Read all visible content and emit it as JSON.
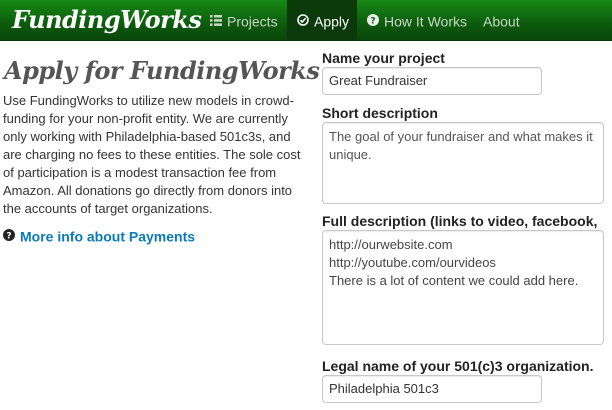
{
  "navbar": {
    "brand": "FundingWorks",
    "items": [
      {
        "label": "Projects",
        "icon": "list-icon",
        "active": false
      },
      {
        "label": "Apply",
        "icon": "check-circle-icon",
        "active": true
      },
      {
        "label": "How It Works",
        "icon": "question-circle-icon",
        "active": false
      },
      {
        "label": "About",
        "icon": "",
        "active": false
      }
    ],
    "colors": {
      "bar": "#0d5e0d",
      "active": "#0a3a0a"
    }
  },
  "intro": {
    "title": "Apply for FundingWorks",
    "body": "Use FundingWorks to utilize new models in crowd-funding for your non-profit entity. We are currently only working with Philadelphia-based 501c3s, and are charging no fees to these entities. The sole cost of participation is a modest transaction fee from Amazon. All donations go directly from donors into the accounts of target organizations.",
    "more_info": "More info about Payments",
    "link_color": "#0a7bb8"
  },
  "form": {
    "project_name": {
      "label": "Name your project",
      "value": "Great Fundraiser"
    },
    "short_description": {
      "label": "Short description",
      "value": "The goal of your fundraiser and what makes it unique."
    },
    "full_description": {
      "label": "Full description (links to video, facebook,",
      "lines": [
        "http://ourwebsite.com",
        "http://youtube.com/ourvideos",
        "There is a lot of content we could add here."
      ]
    },
    "legal_name": {
      "label": "Legal name of your 501(c)3 organization.",
      "value": "Philadelphia 501c3"
    }
  }
}
